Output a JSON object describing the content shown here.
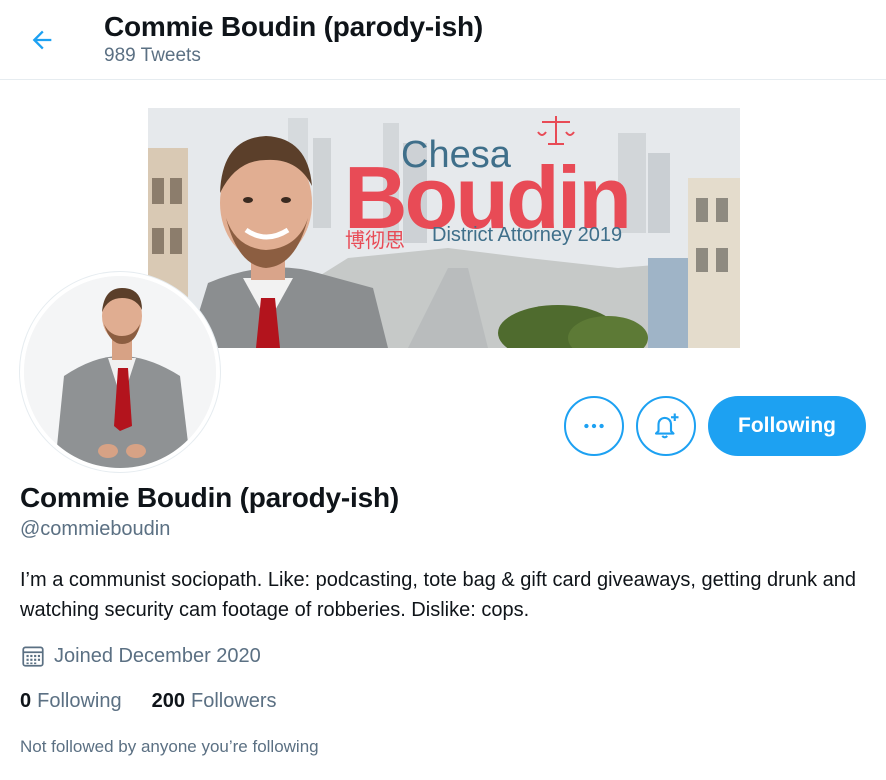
{
  "header": {
    "back_icon": "arrow-left-icon",
    "title": "Commie Boudin (parody-ish)",
    "tweet_count": "989 Tweets"
  },
  "banner": {
    "first_name": "Chesa",
    "last_name": "Boudin",
    "chinese_name": "博彻思",
    "subtitle": "District Attorney 2019",
    "brand_color": "#e84b56",
    "secondary_color": "#3f6f8a"
  },
  "actions": {
    "more_icon": "ellipsis-icon",
    "notify_icon": "bell-plus-icon",
    "follow_label": "Following",
    "accent": "#1da1f2"
  },
  "profile": {
    "name": "Commie Boudin (parody-ish)",
    "handle": "@commieboudin",
    "bio": "I’m a communist sociopath.  Like: podcasting, tote bag & gift card giveaways, getting drunk and watching security cam footage of robberies. Dislike: cops.",
    "joined_icon": "calendar-icon",
    "joined": "Joined December 2020",
    "following_count": "0",
    "following_label": "Following",
    "followers_count": "200",
    "followers_label": "Followers",
    "followed_by": "Not followed by anyone you’re following"
  }
}
